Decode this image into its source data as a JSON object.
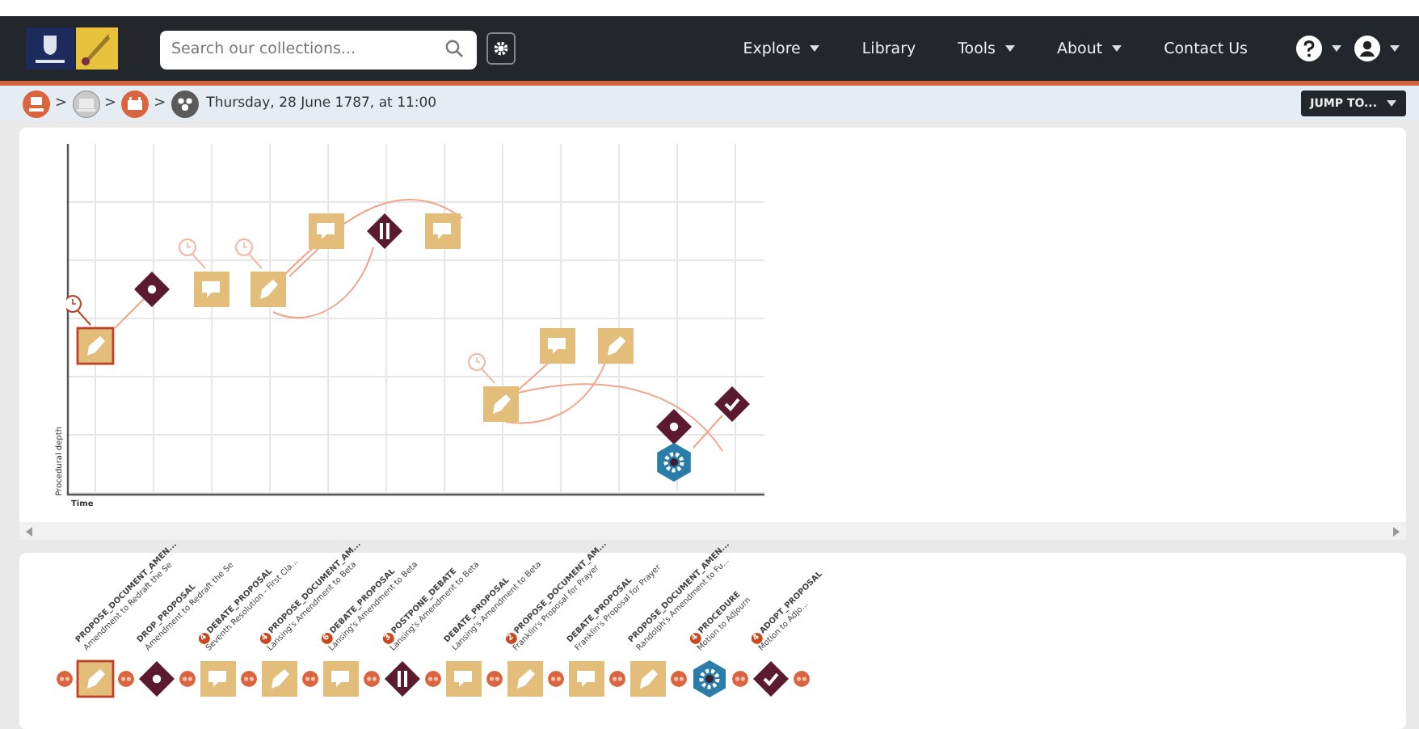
{
  "search": {
    "placeholder": "Search our collections..."
  },
  "nav": [
    {
      "label": "Explore",
      "dropdown": true
    },
    {
      "label": "Library",
      "dropdown": false
    },
    {
      "label": "Tools",
      "dropdown": true
    },
    {
      "label": "About",
      "dropdown": true
    },
    {
      "label": "Contact Us",
      "dropdown": false
    }
  ],
  "breadcrumb": {
    "separator": ">",
    "title": "Thursday, 28 June 1787, at 11:00"
  },
  "jump_button": "JUMP TO...",
  "chart": {
    "ylabel": "Procedural depth",
    "xlabel": "Time",
    "nodes": [
      {
        "kind": "amend",
        "selected": true,
        "clock": true
      },
      {
        "kind": "drop",
        "selected": false,
        "clock": false
      },
      {
        "kind": "debate",
        "selected": false,
        "clock": true
      },
      {
        "kind": "amend",
        "selected": false,
        "clock": true
      },
      {
        "kind": "debate",
        "selected": false,
        "clock": false
      },
      {
        "kind": "postpone",
        "selected": false,
        "clock": false
      },
      {
        "kind": "debate",
        "selected": false,
        "clock": false
      },
      {
        "kind": "amend",
        "selected": false,
        "clock": true
      },
      {
        "kind": "debate",
        "selected": false,
        "clock": false
      },
      {
        "kind": "amend",
        "selected": false,
        "clock": false
      },
      {
        "kind": "drop",
        "selected": false,
        "clock": false
      },
      {
        "kind": "procedure",
        "selected": false,
        "clock": false
      },
      {
        "kind": "adopt",
        "selected": false,
        "clock": false
      }
    ]
  },
  "items": [
    {
      "kind": "amend",
      "selected": true,
      "action": "PROPOSE_DOCUMENT_AMEN...",
      "subject": "Amendment to Redraft the Se"
    },
    {
      "kind": "drop",
      "selected": false,
      "action": "DROP_PROPOSAL",
      "subject": "Amendment to Redraft the Se"
    },
    {
      "kind": "debate",
      "selected": false,
      "badge": "4",
      "action": "DEBATE_PROPOSAL",
      "subject": "Seventh Resolution - First Cla..."
    },
    {
      "kind": "amend",
      "selected": false,
      "badge": "4",
      "action": "PROPOSE_DOCUMENT_AM...",
      "subject": "Lansing's Amendment to Beta"
    },
    {
      "kind": "debate",
      "selected": false,
      "badge": "6",
      "action": "DEBATE_PROPOSAL",
      "subject": "Lansing's Amendment to Beta"
    },
    {
      "kind": "postpone",
      "selected": false,
      "badge": "3",
      "action": "POSTPONE_DEBATE",
      "subject": "Lansing's Amendment to Beta"
    },
    {
      "kind": "debate",
      "selected": false,
      "action": "DEBATE_PROPOSAL",
      "subject": "Lansing's Amendment to Beta"
    },
    {
      "kind": "amend",
      "selected": false,
      "badge": "2",
      "action": "PROPOSE_DOCUMENT_AM...",
      "subject": "Franklin's Proposal for Prayer"
    },
    {
      "kind": "debate",
      "selected": false,
      "action": "DEBATE_PROPOSAL",
      "subject": "Franklin's Proposal for Prayer"
    },
    {
      "kind": "amend",
      "selected": false,
      "action": "PROPOSE_DOCUMENT_AMEN...",
      "subject": "Randolph's Amendment to Fu..."
    },
    {
      "kind": "procedure",
      "selected": false,
      "badge": "4",
      "action": "PROCEDURE",
      "subject": "Motion to Adjourn"
    },
    {
      "kind": "adopt",
      "selected": false,
      "badge": "4",
      "action": "ADOPT_PROPOSAL",
      "subject": "Motion to Adjo..."
    }
  ]
}
